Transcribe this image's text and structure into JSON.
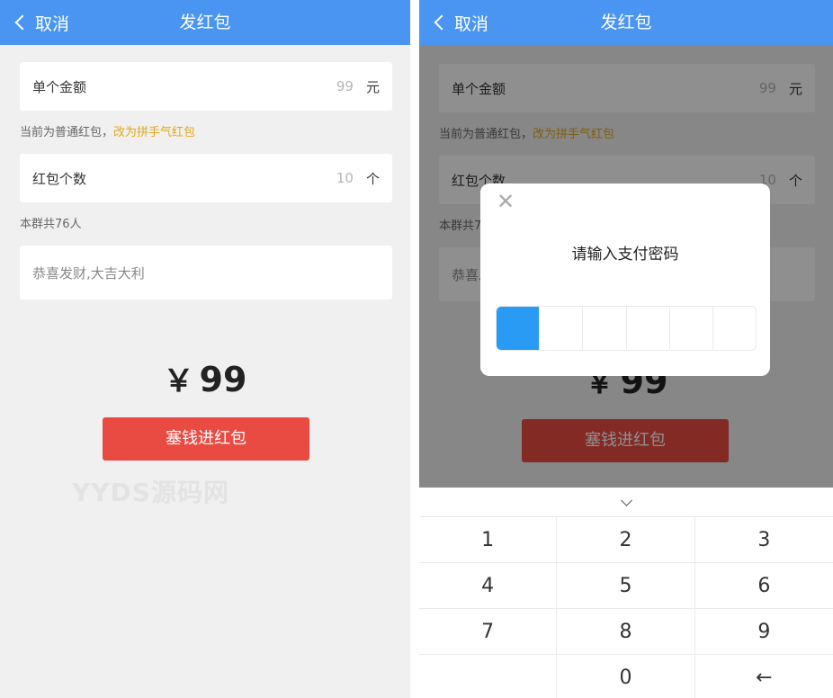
{
  "header": {
    "back_label": "取消",
    "title": "发红包"
  },
  "form": {
    "amount_label": "单个金额",
    "amount_value": "99",
    "amount_unit": "元",
    "type_hint": "当前为普通红包，",
    "type_switch_link": "改为拼手气红包",
    "count_label": "红包个数",
    "count_value": "10",
    "count_unit": "个",
    "group_hint": "本群共76人",
    "message_placeholder": "恭喜发财,大吉大利",
    "total_currency": "￥",
    "total_amount": "99",
    "submit_label": "塞钱进红包"
  },
  "watermark": "YYDS源码网",
  "dialog": {
    "close_glyph": "✕",
    "title": "请输入支付密码",
    "digits_entered": 1,
    "digit_total": 6
  },
  "keyboard": {
    "keys": [
      "1",
      "2",
      "3",
      "4",
      "5",
      "6",
      "7",
      "8",
      "9",
      "",
      "0",
      "←"
    ]
  },
  "colors": {
    "header": "#4a95f2",
    "submit": "#e94b43",
    "link": "#e3a81b",
    "active_cell": "#2a9bf4"
  }
}
